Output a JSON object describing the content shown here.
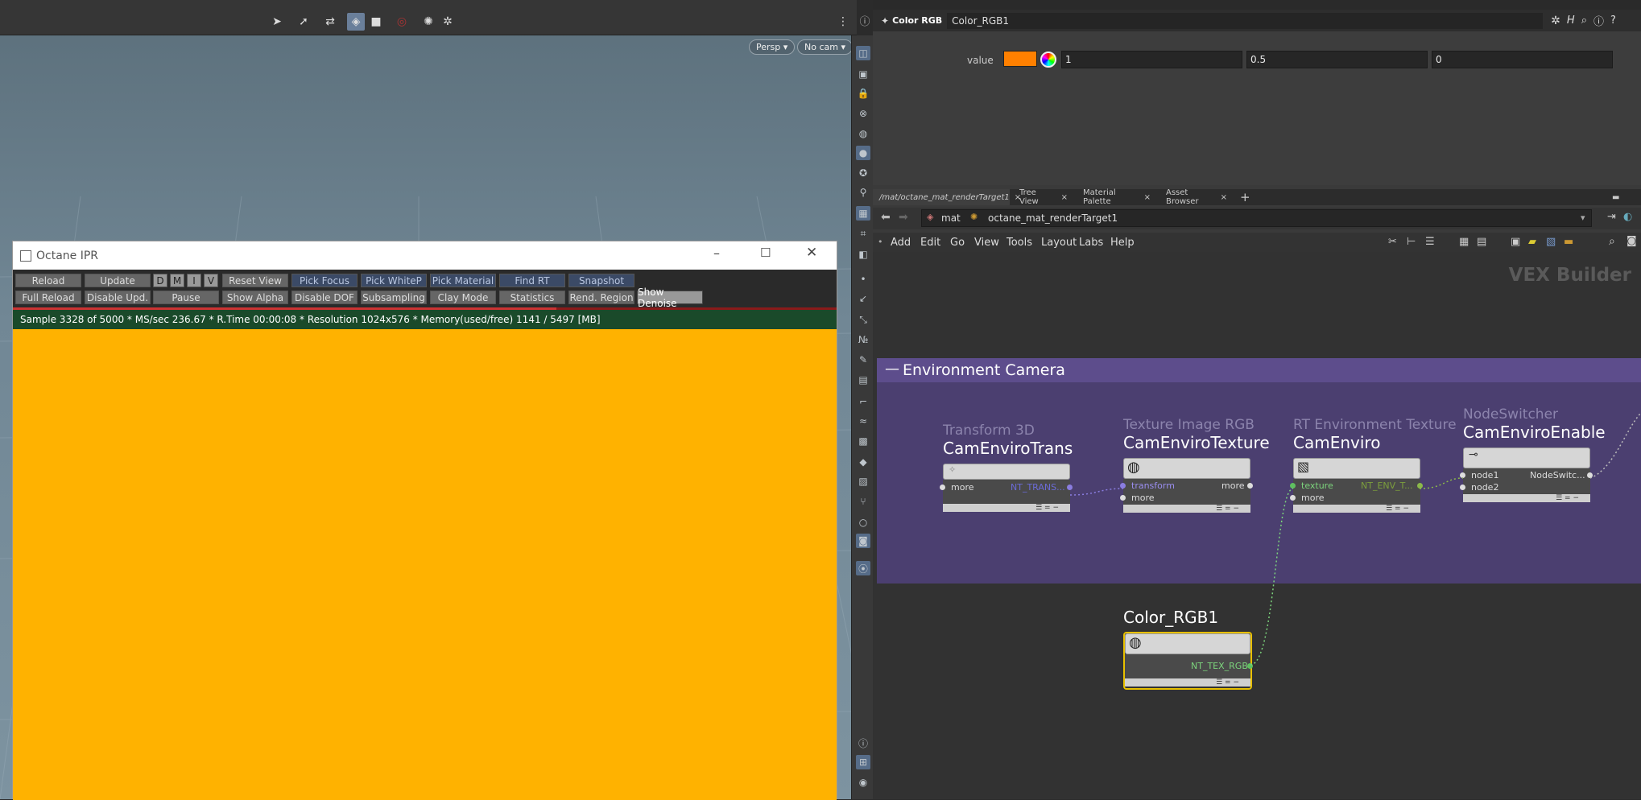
{
  "viewport": {
    "persp_label": "Persp ▾",
    "cam_label": "No cam ▾"
  },
  "ipr": {
    "title": "Octane IPR",
    "row1": [
      "Reload",
      "Update",
      "D",
      "M",
      "I",
      "V",
      "Reset View",
      "Pick Focus",
      "Pick WhiteP",
      "Pick Material",
      "Find RT",
      "Snapshot"
    ],
    "row2": [
      "Full Reload",
      "Disable Upd.",
      "Pause",
      "Show Alpha",
      "Disable DOF",
      "Subsampling",
      "Clay Mode",
      "Statistics",
      "Rend. Region",
      "Show Denoise"
    ],
    "status": "Sample 3328 of 5000 * MS/sec 236.67 * R.Time 00:00:08 * Resolution 1024x576 * Memory(used/free) 1141 / 5497 [MB]"
  },
  "params": {
    "type_label": "Color RGB",
    "node_name": "Color_RGB1",
    "value_label": "value",
    "r": "1",
    "g": "0.5",
    "b": "0",
    "swatch": "#ff8000"
  },
  "tabs": [
    {
      "label": "/mat/octane_mat_renderTarget1",
      "active": true
    },
    {
      "label": "Tree View"
    },
    {
      "label": "Material Palette"
    },
    {
      "label": "Asset Browser"
    }
  ],
  "path": {
    "root": "mat",
    "child": "octane_mat_renderTarget1"
  },
  "menu": [
    "Add",
    "Edit",
    "Go",
    "View",
    "Tools",
    "Layout",
    "Labs",
    "Help"
  ],
  "network": {
    "context": "VEX Builder",
    "box_title": "Environment Camera",
    "nodes": [
      {
        "type": "Transform 3D",
        "name": "CamEnviroTrans",
        "in1": "more",
        "out": "NT_TRANS..."
      },
      {
        "type": "Texture Image RGB",
        "name": "CamEnviroTexture",
        "in1": "transform",
        "in2": "more",
        "out": "more"
      },
      {
        "type": "RT Environment Texture",
        "name": "CamEnviro",
        "in1": "texture",
        "in2": "more",
        "out": "NT_ENV_T..."
      },
      {
        "type": "NodeSwitcher",
        "name": "CamEnviroEnable",
        "in1": "node1",
        "in2": "node2",
        "out": "NodeSwitc..."
      },
      {
        "name": "Color_RGB1",
        "out": "NT_TEX_RGB"
      }
    ]
  },
  "colors": {
    "render": "#ffb200",
    "box": "#4b3f70",
    "selected": "#e8c000"
  }
}
